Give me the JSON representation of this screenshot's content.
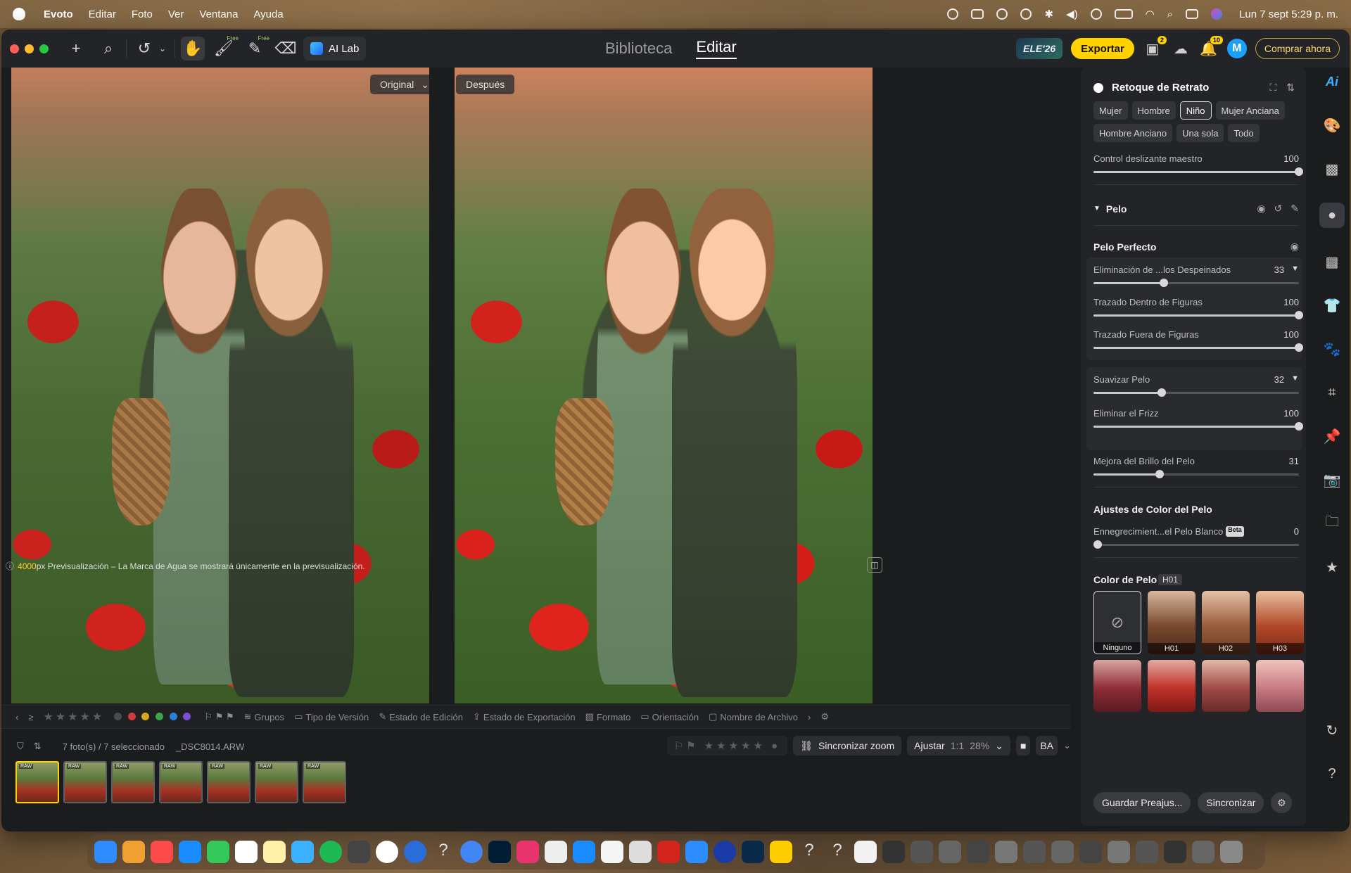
{
  "menubar": {
    "app_name": "Evoto",
    "items": [
      "Editar",
      "Foto",
      "Ver",
      "Ventana",
      "Ayuda"
    ],
    "clock": "Lun 7 sept  5:29 p. m."
  },
  "toolbar": {
    "free_tag": "Free",
    "ai_lab_label": "AI Lab",
    "tabs": [
      "Biblioteca",
      "Editar"
    ],
    "active_tab": "Editar",
    "ele_badge": "ELE'26",
    "export_label": "Exportar",
    "notif_count_1": "2",
    "notif_count_2": "10",
    "avatar_initial": "M",
    "buy_label": "Comprar ahora"
  },
  "viewer": {
    "original_label": "Original",
    "after_label": "Después",
    "watermark_highlight": "4000",
    "watermark_text": "px Previsualización – La Marca de Agua se mostrará únicamente en la previsualización."
  },
  "filter_bar": {
    "groups": "Grupos",
    "version_type": "Tipo de Versión",
    "edit_state": "Estado de Edición",
    "export_state": "Estado de Exportación",
    "format": "Formato",
    "orientation": "Orientación",
    "file_name": "Nombre de Archivo",
    "color_labels": [
      "#d23b3b",
      "#d6a51f",
      "#3aa24a",
      "#2f7fd8",
      "#7a4fd0"
    ]
  },
  "status_bar": {
    "selection": "7 foto(s) / 7 seleccionado",
    "file_name": "_DSC8014.ARW",
    "sync_zoom": "Sincronizar zoom",
    "fit": "Ajustar",
    "one_to_one": "1:1",
    "zoom": "28%"
  },
  "filmstrip": {
    "thumbs": [
      "RAW",
      "RAW",
      "RAW",
      "RAW",
      "RAW",
      "RAW",
      "RAW"
    ]
  },
  "panel": {
    "title": "Retoque de Retrato",
    "subjects": [
      "Mujer",
      "Hombre",
      "Niño",
      "Mujer Anciana",
      "Hombre Anciano",
      "Una sola",
      "Todo"
    ],
    "active_subject": "Niño",
    "master_slider": {
      "label": "Control deslizante maestro",
      "value": 100
    },
    "hair_section": "Pelo",
    "perfect_hair": "Pelo Perfecto",
    "sliders_group1": [
      {
        "label": "Eliminación de ...los Despeinados",
        "value": 33
      },
      {
        "label": "Trazado Dentro de Figuras",
        "value": 100
      },
      {
        "label": "Trazado Fuera de Figuras",
        "value": 100
      }
    ],
    "sliders_group2": [
      {
        "label": "Suavizar Pelo",
        "value": 32
      },
      {
        "label": "Eliminar el Frizz",
        "value": 100
      }
    ],
    "shine_slider": {
      "label": "Mejora del Brillo del Pelo",
      "value": 31
    },
    "hair_color_adjust": "Ajustes de Color del Pelo",
    "gray_slider": {
      "label": "Ennegrecimient...el Pelo Blanco",
      "value": 0,
      "beta": "Beta"
    },
    "hair_color_title": "Color de Pelo",
    "hair_tooltip": "H01",
    "swatches": [
      "Ninguno",
      "H01",
      "H02",
      "H03"
    ],
    "save_preset": "Guardar Preajus...",
    "sync": "Sincronizar"
  },
  "icons": {
    "add": "+",
    "search": "⌕",
    "undo": "↺",
    "hand": "✋",
    "eraser": "⌫"
  }
}
